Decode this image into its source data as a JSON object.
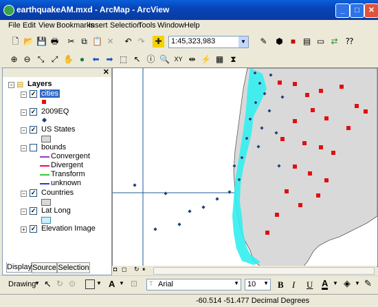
{
  "window": {
    "title": "earthquakeAM.mxd - ArcMap - ArcView",
    "minimize": "_",
    "maximize": "□",
    "close": "✕"
  },
  "menu": [
    "File",
    "Edit",
    "View",
    "Bookmarks",
    "Insert",
    "Selection",
    "Tools",
    "Window",
    "Help"
  ],
  "toolbar": {
    "scale": "1:45,323,983"
  },
  "toc": {
    "root_label": "Layers",
    "layers": [
      {
        "name": "cities",
        "checked": true
      },
      {
        "name": "2009EQ",
        "checked": true
      },
      {
        "name": "US States",
        "checked": true
      },
      {
        "name": "bounds",
        "checked": false
      },
      {
        "name": "Countries",
        "checked": true
      },
      {
        "name": "Lat Long",
        "checked": true
      },
      {
        "name": "Elevation Image",
        "checked": true
      }
    ],
    "bounds_legend": [
      {
        "label": "Convergent",
        "color": "#9933cc"
      },
      {
        "label": "Divergent",
        "color": "#ff0066"
      },
      {
        "label": "Transform",
        "color": "#33cc33"
      },
      {
        "label": "unknown",
        "color": "#3333cc"
      }
    ],
    "tabs": [
      "Display",
      "Source",
      "Selection"
    ]
  },
  "drawing": {
    "label": "Drawing",
    "font": "Arial",
    "size": "10",
    "bold": "B",
    "italic": "I",
    "underline": "U",
    "text_tool": "A"
  },
  "status": {
    "coordinates": "-60.514  -51.477 Decimal Degrees"
  },
  "colors": {
    "cities": "#e01010",
    "quakes": "#1f3f7a",
    "land": "#d9d9d9",
    "elevation": "#33eeee",
    "titlebar": "#0a5fd8"
  }
}
